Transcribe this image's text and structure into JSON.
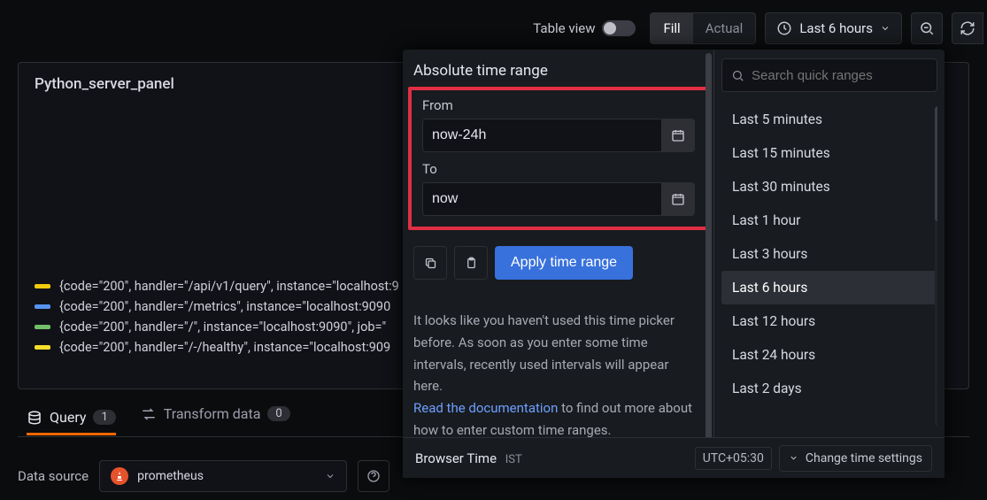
{
  "toolbar": {
    "table_view_label": "Table view",
    "fill_label": "Fill",
    "actual_label": "Actual",
    "time_range_label": "Last 6 hours"
  },
  "panel": {
    "title": "Python_server_panel",
    "legend": [
      {
        "color": "#f2cc0c",
        "text": "{code=\"200\", handler=\"/api/v1/query\", instance=\"localhost:9"
      },
      {
        "color": "#5794f2",
        "text": "{code=\"200\", handler=\"/metrics\", instance=\"localhost:9090"
      },
      {
        "color": "#73bf69",
        "text": "{code=\"200\", handler=\"/\", instance=\"localhost:9090\", job=\""
      },
      {
        "color": "#fade2a",
        "text": "{code=\"200\", handler=\"/-/healthy\", instance=\"localhost:909"
      }
    ]
  },
  "tabs": {
    "query_label": "Query",
    "query_count": "1",
    "transform_label": "Transform data",
    "transform_count": "0"
  },
  "datasource": {
    "label": "Data source",
    "selected": "prometheus"
  },
  "timepicker": {
    "title": "Absolute time range",
    "from_label": "From",
    "from_value": "now-24h",
    "to_label": "To",
    "to_value": "now",
    "apply_label": "Apply time range",
    "hint_1": "It looks like you haven't used this time picker before. As soon as you enter some time intervals, recently used intervals will appear here.",
    "doc_link_label": "Read the documentation",
    "hint_2": " to find out more about how to enter custom time ranges.",
    "search_placeholder": "Search quick ranges",
    "quick_ranges": [
      "Last 5 minutes",
      "Last 15 minutes",
      "Last 30 minutes",
      "Last 1 hour",
      "Last 3 hours",
      "Last 6 hours",
      "Last 12 hours",
      "Last 24 hours",
      "Last 2 days"
    ],
    "selected_range_index": 5,
    "browser_time_label": "Browser Time",
    "tz_short": "IST",
    "utc_offset": "UTC+05:30",
    "change_settings_label": "Change time settings"
  }
}
